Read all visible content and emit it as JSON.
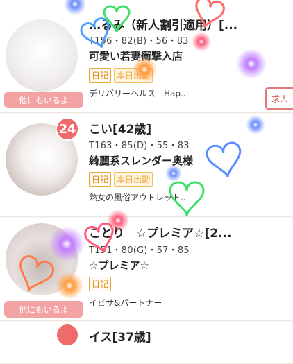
{
  "cards": [
    {
      "name": "…るみ（新人割引適用）[...",
      "stats": "T156・82(B)・56・83",
      "catch": "可愛い若妻衝撃入店",
      "tags": [
        "日記",
        "本日出勤"
      ],
      "shop": "デリバリーヘルス　Hap...",
      "others": "他にもいるよ"
    },
    {
      "age": "24",
      "name": "こい[42歳]",
      "stats": "T163・85(D)・55・83",
      "catch": "綺麗系スレンダー奥様",
      "tags": [
        "日記",
        "本日出勤"
      ],
      "shop": "熟女の風俗アウトレット..."
    },
    {
      "name": "ことり　☆プレミア☆[2...",
      "stats": "T151・80(G)・57・85",
      "catch": "☆プレミア☆",
      "tags": [
        "日記"
      ],
      "shop": "イビサ&パートナー",
      "others": "他にもいるよ"
    },
    {
      "name": "イス[37歳]"
    }
  ],
  "recruit": "求人",
  "colors": {
    "badge": "#ef6a6a",
    "others_button": "#f3a3a3",
    "tag": "#e8a43c"
  }
}
